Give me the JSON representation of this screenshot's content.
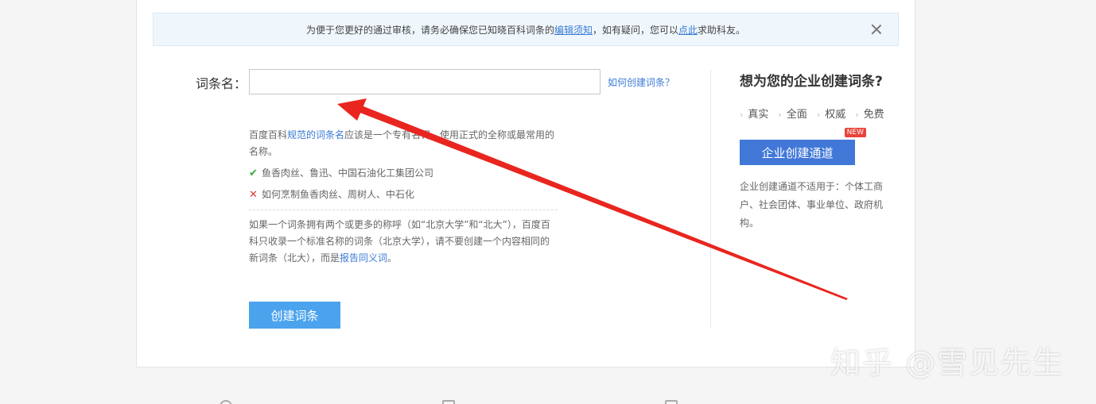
{
  "notice": {
    "text_before": "为便于您更好的通过审核，请务必确保您已知晓百科词条的",
    "link1": "编辑须知",
    "text_middle": "，如有疑问，您可以",
    "link2": "点此",
    "text_after": "求助科友。"
  },
  "form": {
    "label": "词条名：",
    "input_value": "",
    "input_placeholder": "",
    "help_link": "如何创建词条？",
    "create_label": "创建词条"
  },
  "tips": {
    "line1_before": "百度百科",
    "line1_link": "规范的词条名",
    "line1_after": "应该是一个专有名词，使用正式的全称或最常用的名称。",
    "good_example": "鱼香肉丝、鲁迅、中国石油化工集团公司",
    "bad_example": "如何烹制鱼香肉丝、周树人、中石化",
    "para2_before": "如果一个词条拥有两个或更多的称呼（如“北京大学”和“北大”），百度百科只收录一个标准名称的词条（北京大学），请不要创建一个内容相同的新词条（北大），而是",
    "para2_link": "报告同义词",
    "para2_after": "。",
    "good_mark": "✔",
    "bad_mark": "✕"
  },
  "side": {
    "title": "想为您的企业创建词条?",
    "tags": [
      "真实",
      "全面",
      "权威",
      "免费"
    ],
    "button": "企业创建通道",
    "badge": "NEW",
    "note": "企业创建通道不适用于：个体工商户、社会团体、事业单位、政府机构。"
  },
  "watermark": "知乎 @雪见先生",
  "colors": {
    "accent": "#4ba3ee",
    "enterprise": "#4178d8",
    "arrow": "#e8261f",
    "link": "#3a7bd5"
  }
}
